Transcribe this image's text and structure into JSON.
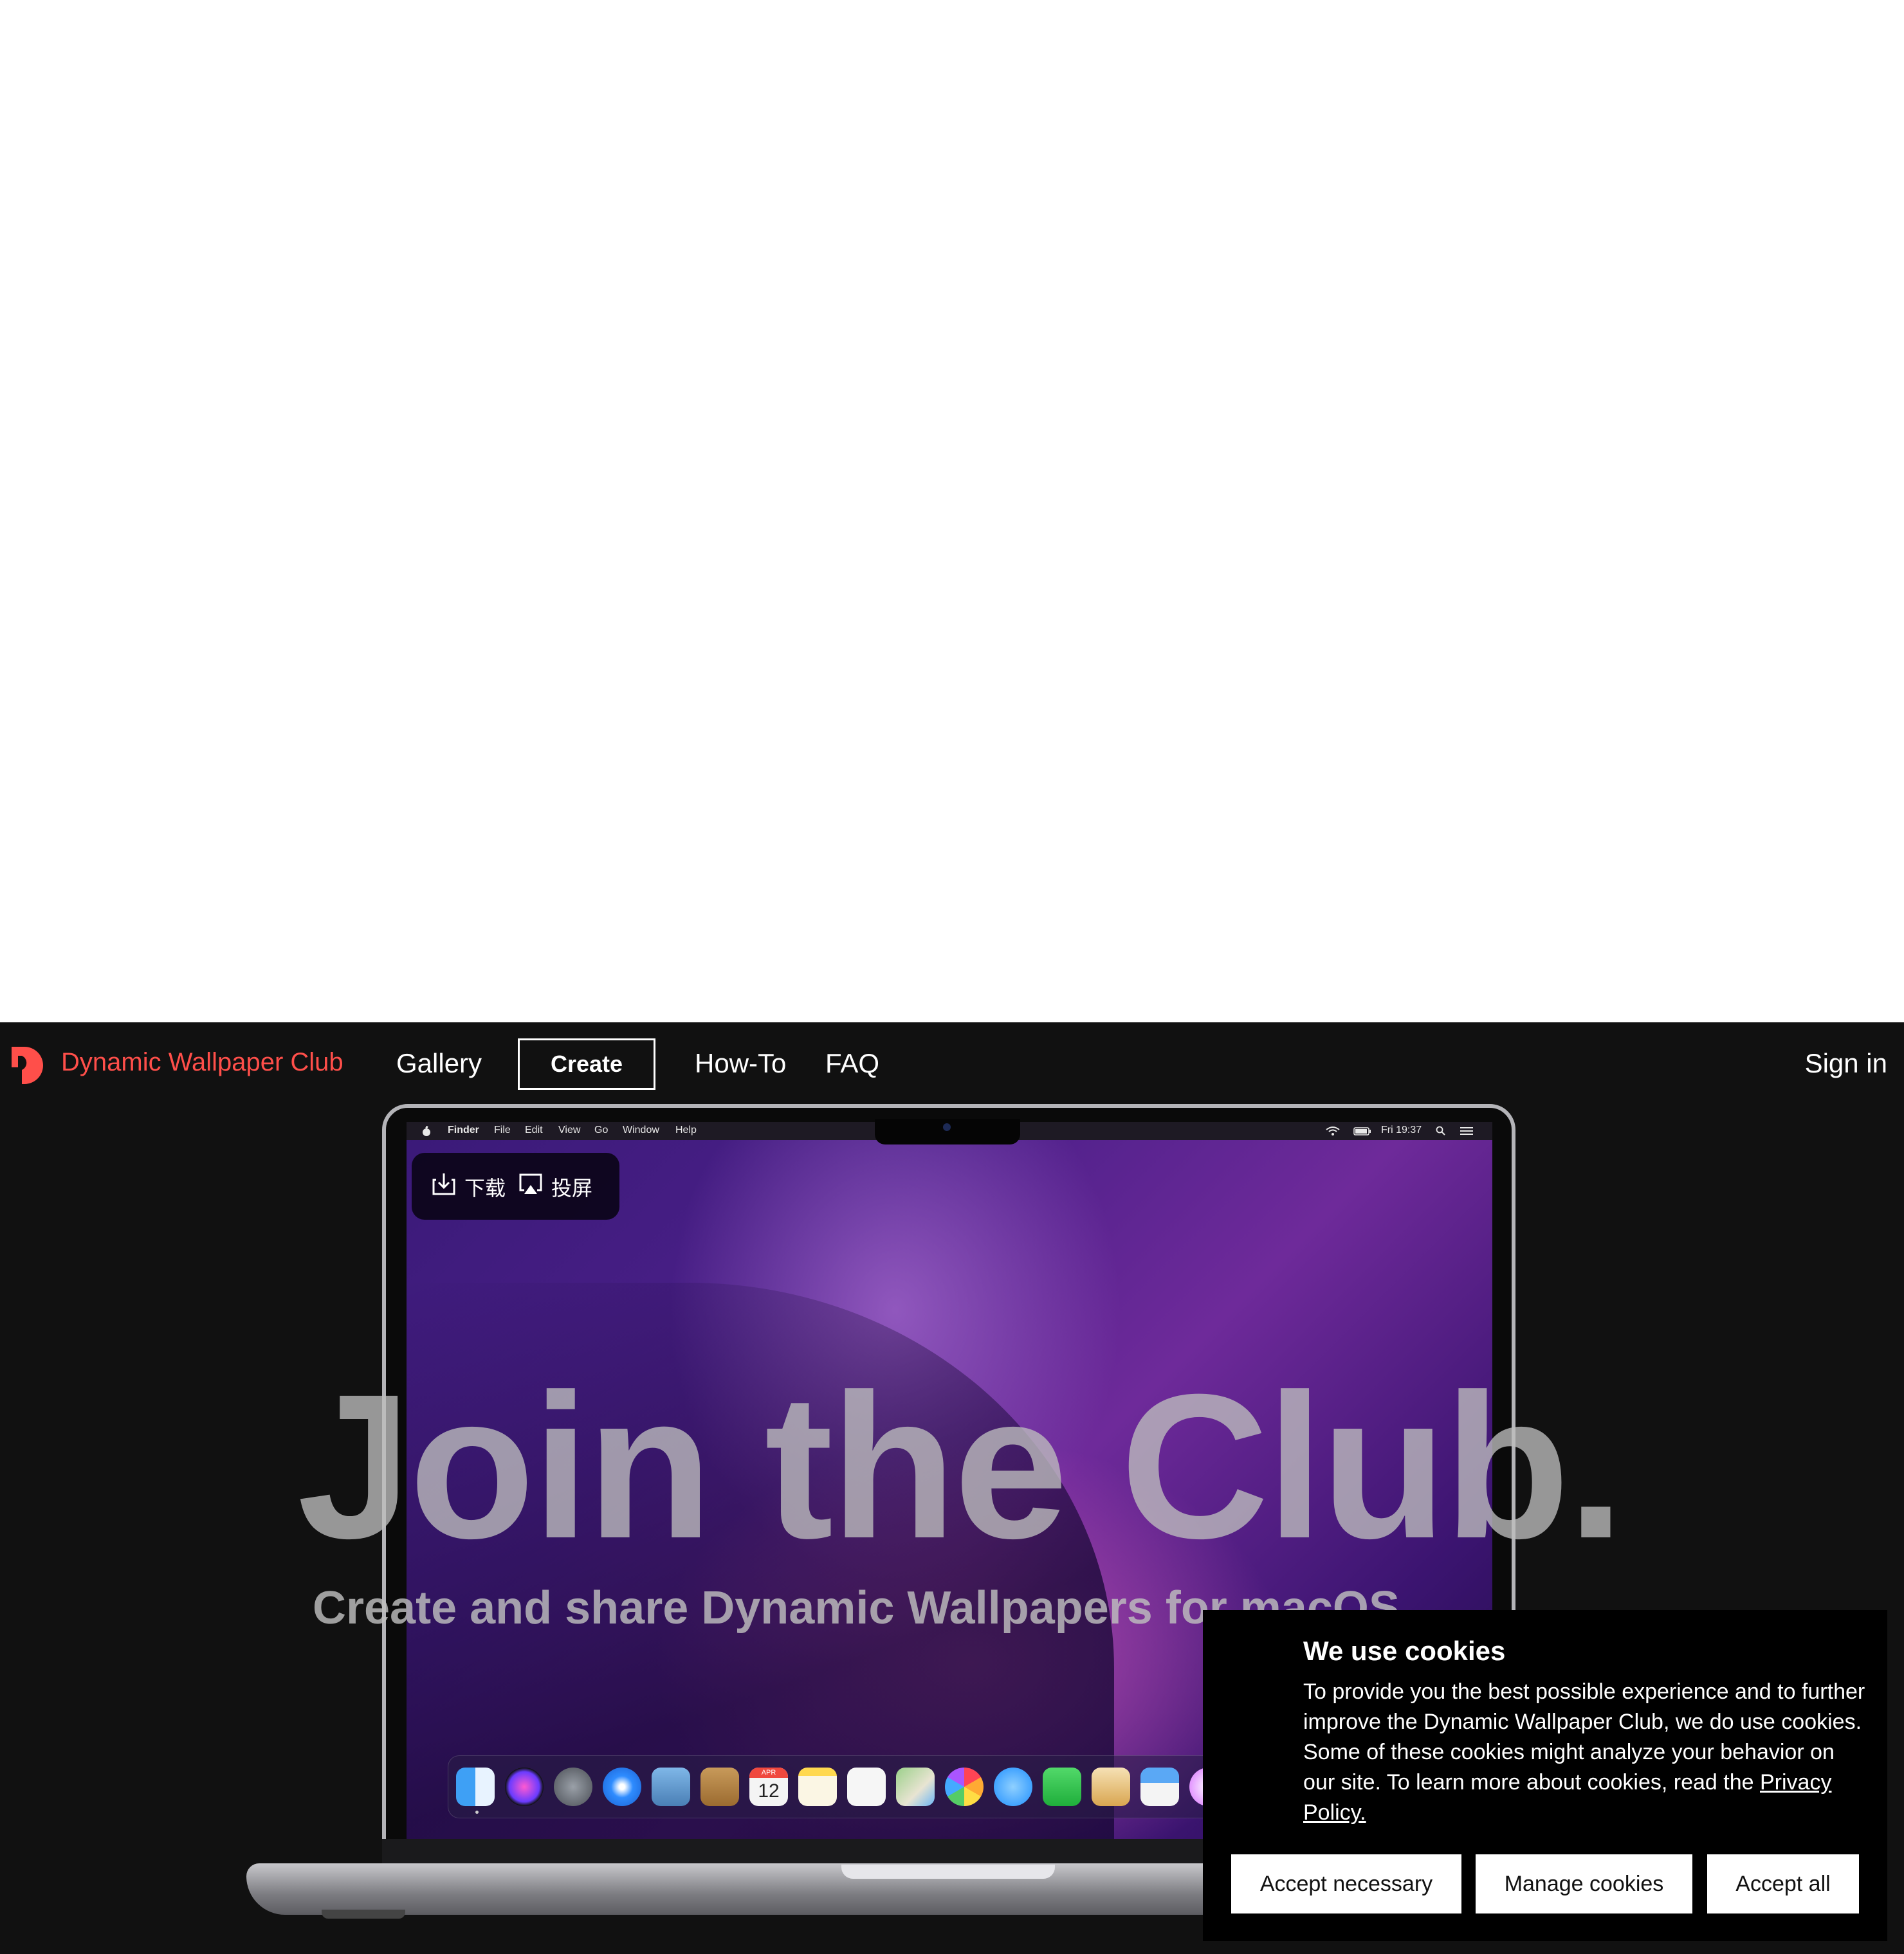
{
  "nav": {
    "brand": "Dynamic Wallpaper Club",
    "links": [
      "Gallery",
      "Create",
      "How-To",
      "FAQ"
    ],
    "sign_in": "Sign in",
    "brand_color": "#ff4f4a"
  },
  "mac_menubar": {
    "apple": "",
    "items": [
      "Finder",
      "File",
      "Edit",
      "View",
      "Go",
      "Window",
      "Help"
    ],
    "clock": "Fri 19:37"
  },
  "overlay": {
    "download_label": "下载",
    "cast_label": "投屏"
  },
  "dock": {
    "calendar_month": "APR",
    "calendar_day": "12"
  },
  "hero": {
    "title": "Join the Club.",
    "subtitle": "Create and share Dynamic Wallpapers for macOS"
  },
  "cookie": {
    "title": "We use cookies",
    "body": "To provide you the best possible experience and to further improve the Dynamic Wallpaper Club, we do use cookies. Some of these cookies might analyze your behavior on our site. To learn more about cookies, read the ",
    "link": "Privacy Policy.",
    "buttons": {
      "accept_necessary": "Accept necessary",
      "manage": "Manage cookies",
      "accept_all": "Accept all"
    }
  }
}
